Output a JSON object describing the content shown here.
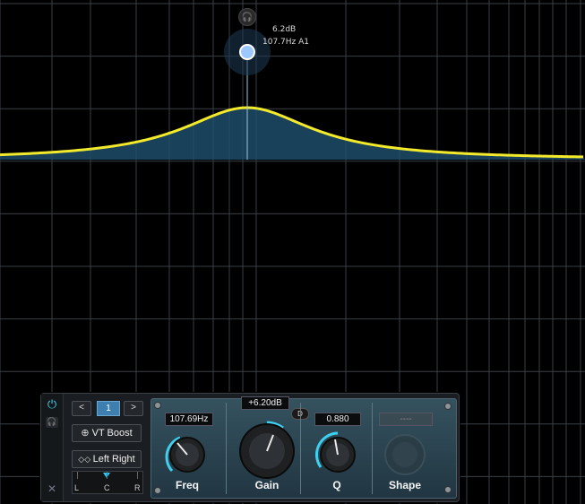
{
  "tooltip": {
    "gain": "6.2dB",
    "freq_band": "107.7Hz A1"
  },
  "colors": {
    "curve": "#f2ea2a",
    "fill": "#1f4c6a",
    "grid": "#3a3f44",
    "accent": "#3fd0f0"
  },
  "controls": {
    "power_icon": "power-icon",
    "headphone_icon": "headphones-icon",
    "close_icon": "close-icon",
    "prev_label": "<",
    "next_label": ">",
    "band_number": "1",
    "preset_label": "VT Boost",
    "channel_label": "Left Right",
    "pan": {
      "left": "L",
      "center": "C",
      "right": "R"
    }
  },
  "knobs": {
    "freq": {
      "label": "Freq",
      "readout": "107.69Hz"
    },
    "gain": {
      "label": "Gain",
      "readout": "+6.20dB",
      "dyn_label": "D"
    },
    "q": {
      "label": "Q",
      "readout": "0.880"
    },
    "shape": {
      "label": "Shape",
      "readout": "----"
    }
  }
}
